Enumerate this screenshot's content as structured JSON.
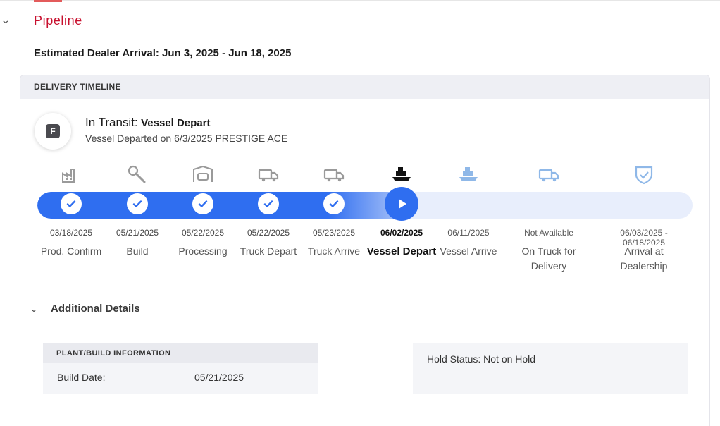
{
  "section": {
    "title": "Pipeline"
  },
  "eta": {
    "text": "Estimated Dealer Arrival: Jun 3, 2025 - Jun 18, 2025"
  },
  "timeline_card": {
    "header": "DELIVERY TIMELINE",
    "badge_letter": "F",
    "status_label": "In Transit:",
    "status_value": "Vessel Depart",
    "status_detail": "Vessel Departed on 6/3/2025 PRESTIGE ACE"
  },
  "progress": {
    "completed_fraction": 0.555
  },
  "steps": [
    {
      "date": "03/18/2025",
      "label": "Prod. Confirm",
      "state": "done",
      "icon": "factory-icon"
    },
    {
      "date": "05/21/2025",
      "label": "Build",
      "state": "done",
      "icon": "wrench-icon"
    },
    {
      "date": "05/22/2025",
      "label": "Processing",
      "state": "done",
      "icon": "car-garage-icon"
    },
    {
      "date": "05/22/2025",
      "label": "Truck Depart",
      "state": "done",
      "icon": "truck-icon"
    },
    {
      "date": "05/23/2025",
      "label": "Truck Arrive",
      "state": "done",
      "icon": "truck-icon"
    },
    {
      "date": "06/02/2025",
      "label": "Vessel Depart",
      "state": "current",
      "icon": "ship-icon"
    },
    {
      "date": "06/11/2025",
      "label": "Vessel Arrive",
      "state": "future",
      "icon": "ship-icon"
    },
    {
      "date": "Not Available",
      "label": "On Truck for Delivery",
      "state": "future",
      "icon": "truck-icon"
    },
    {
      "date": "06/03/2025 - 06/18/2025",
      "label": "Arrival at Dealership",
      "state": "future",
      "icon": "shield-check-icon"
    }
  ],
  "additional": {
    "title": "Additional Details",
    "plant_header": "PLANT/BUILD INFORMATION",
    "build_date_label": "Build Date:",
    "build_date_value": "05/21/2025",
    "hold_status": "Hold Status: Not on Hold"
  },
  "colors": {
    "accent_red": "#c8102e",
    "progress_blue": "#2f6ef0",
    "future_icon": "#8fb8e8"
  }
}
